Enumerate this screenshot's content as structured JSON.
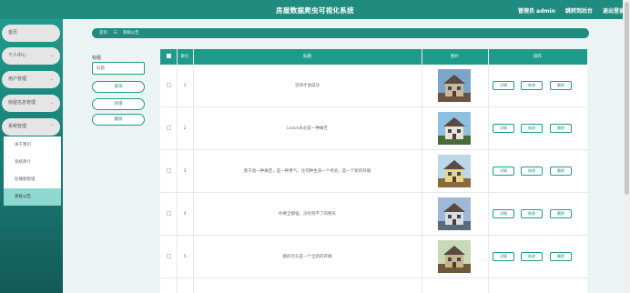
{
  "header": {
    "title": "房屋数据爬虫可视化系统",
    "admin": "管理员 admin",
    "dashboard": "跳转到后台",
    "logout": "退出登录"
  },
  "sidebar": {
    "items": [
      {
        "label": "首页",
        "has_chevron": false
      },
      {
        "label": "个人中心",
        "has_chevron": true
      },
      {
        "label": "用户管理",
        "has_chevron": true
      },
      {
        "label": "房屋信息管理",
        "has_chevron": true
      },
      {
        "label": "系统管理",
        "has_chevron": true
      }
    ],
    "submenu": [
      "关于我们",
      "系统简介",
      "轮播图管理",
      "系统公告"
    ],
    "active_sub": "系统公告"
  },
  "breadcrumb": {
    "home": "首页",
    "separator": "☰",
    "current": "系统公告"
  },
  "search": {
    "label": "标题",
    "placeholder": "标题",
    "query_button": "查询",
    "add_button": "新增",
    "delete_button": "删除"
  },
  "table": {
    "headers": {
      "index": "索引",
      "title": "标题",
      "image": "图片",
      "actions": "操作"
    },
    "rows": [
      {
        "index": "1",
        "title": "坚持才会成功"
      },
      {
        "index": "2",
        "title": "Leave未必是一种痛苦"
      },
      {
        "index": "3",
        "title": "勇于放一种痛苦，是一种勇气，任何种生孩一个考验，是一个新的开端"
      },
      {
        "index": "4",
        "title": "你要全都强，没有到不了的明天"
      },
      {
        "index": "5",
        "title": "路的尽头是一个全新的开端"
      }
    ],
    "action_labels": {
      "detail": "详情",
      "edit": "修改",
      "delete": "删除"
    }
  },
  "colors": {
    "primary": "#1f8c7f",
    "accent": "#1f9a8b",
    "active_sub": "#8ed8d0"
  }
}
